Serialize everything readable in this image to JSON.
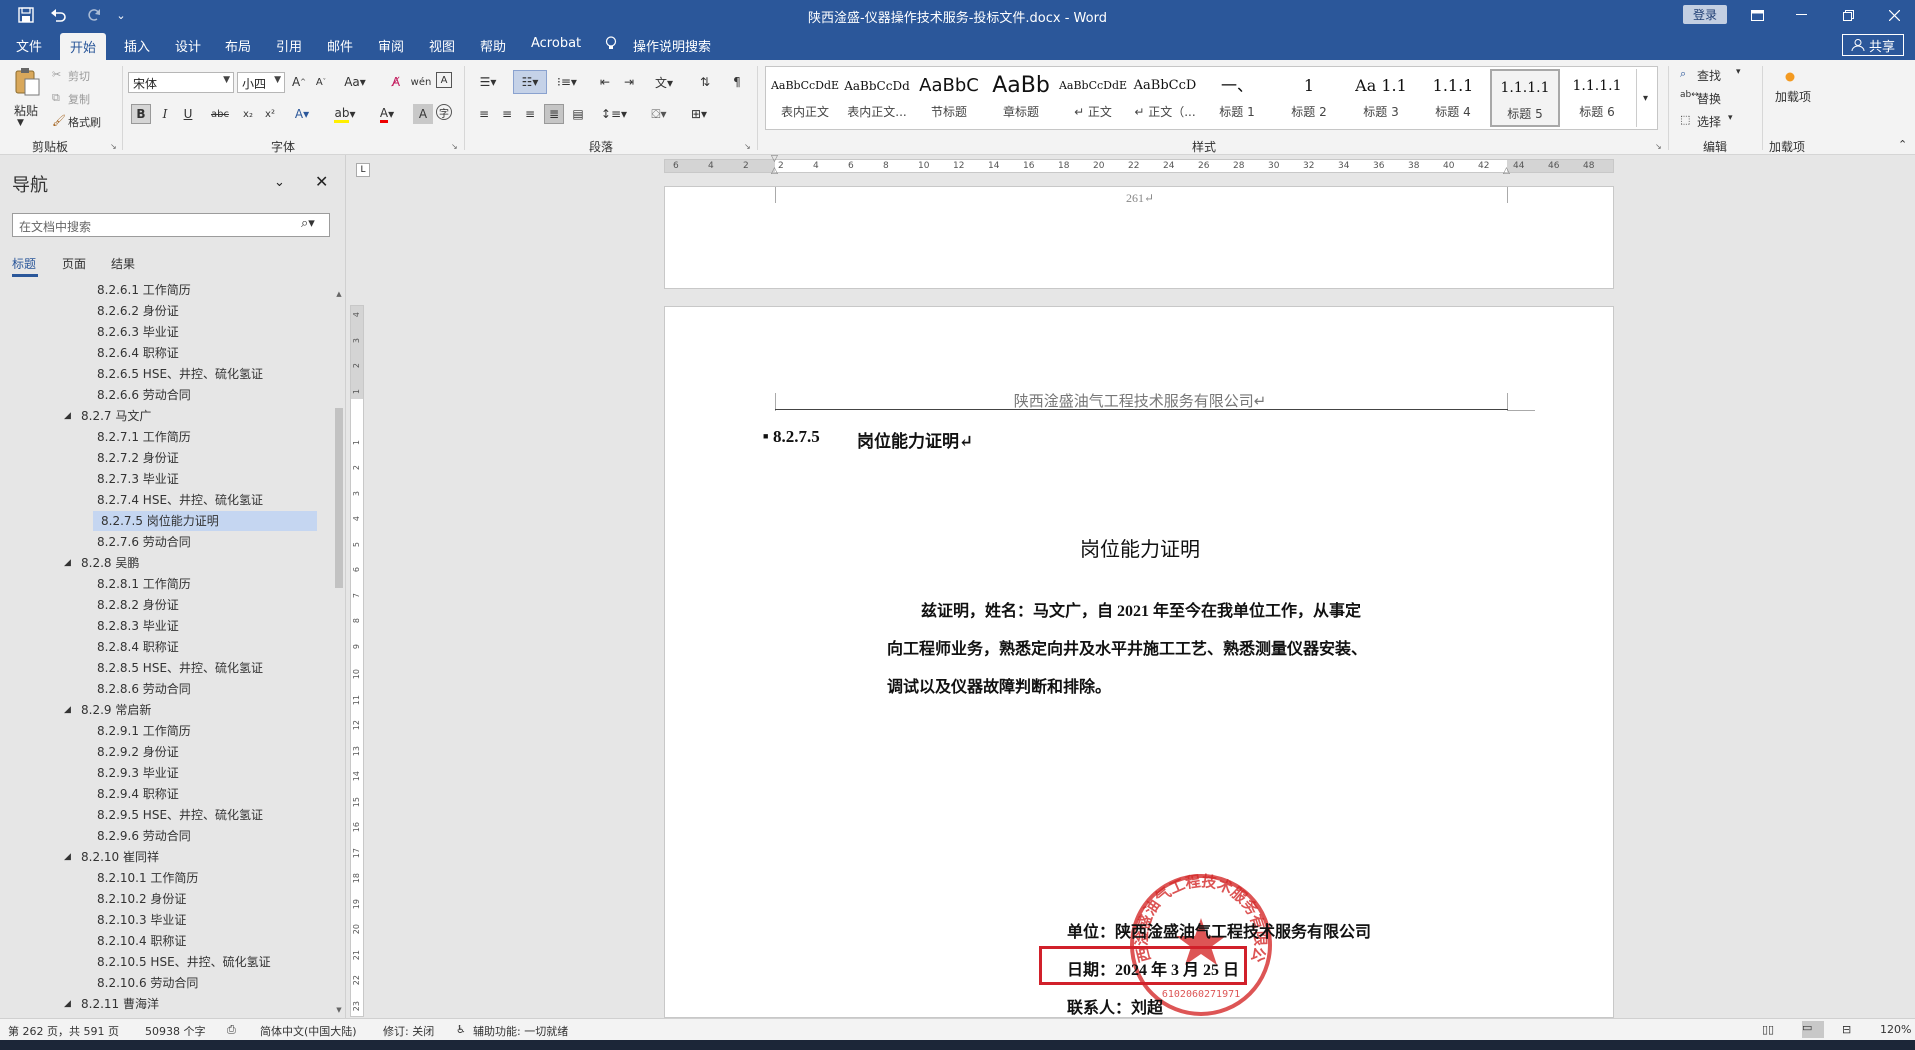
{
  "title_bar": {
    "document_title": "陕西淦盛-仪器操作技术服务-投标文件.docx - Word",
    "login_label": "登录",
    "save_icon": "save-icon",
    "undo_icon": "undo-icon",
    "redo_icon": "redo-icon",
    "customize_icon": "customize-quick-access-icon"
  },
  "menu": {
    "tabs": [
      "文件",
      "开始",
      "插入",
      "设计",
      "布局",
      "引用",
      "邮件",
      "审阅",
      "视图",
      "帮助",
      "Acrobat"
    ],
    "active_tab": "开始",
    "tell_me": "操作说明搜索",
    "share_label": "共享"
  },
  "ribbon": {
    "clipboard": {
      "paste": "粘贴",
      "cut": "剪切",
      "copy": "复制",
      "format_painter": "格式刷",
      "label": "剪贴板"
    },
    "font": {
      "name": "宋体",
      "size": "小四",
      "label": "字体"
    },
    "paragraph": {
      "label": "段落"
    },
    "styles": {
      "label": "样式",
      "items": [
        {
          "preview": "AaBbCcDdE",
          "name": "表内正文"
        },
        {
          "preview": "AaBbCcDd",
          "name": "表内正文..."
        },
        {
          "preview": "AaBbC",
          "name": "节标题"
        },
        {
          "preview": "AaBb",
          "name": "章标题"
        },
        {
          "preview": "AaBbCcDdE",
          "name": "↵ 正文"
        },
        {
          "preview": "AaBbCcD",
          "name": "↵ 正文（..."
        },
        {
          "preview": "一、",
          "name": "标题 1"
        },
        {
          "preview": "1",
          "name": "标题 2"
        },
        {
          "preview": "Aa",
          "name": "标题 3"
        },
        {
          "preview": "1.1",
          "name": "标题 3"
        },
        {
          "preview": "1.1.1",
          "name": "标题 4"
        },
        {
          "preview": "1.1.1.1",
          "name": "标题 5"
        },
        {
          "preview": "1.1.1.1",
          "name": "标题 6"
        }
      ],
      "selected_index": 11
    },
    "editing": {
      "find": "查找",
      "replace": "替换",
      "select": "选择",
      "label": "编辑"
    },
    "addins": {
      "button": "加载项",
      "label": "加载项"
    }
  },
  "nav": {
    "title": "导航",
    "search_placeholder": "在文档中搜索",
    "tabs": [
      "标题",
      "页面",
      "结果"
    ],
    "items": [
      {
        "text": "8.2.6.1 工作简历",
        "level": 2,
        "expandable": false
      },
      {
        "text": "8.2.6.2 身份证",
        "level": 2,
        "expandable": false
      },
      {
        "text": "8.2.6.3 毕业证",
        "level": 2,
        "expandable": false
      },
      {
        "text": "8.2.6.4 职称证",
        "level": 2,
        "expandable": false
      },
      {
        "text": "8.2.6.5 HSE、井控、硫化氢证",
        "level": 2,
        "expandable": false
      },
      {
        "text": "8.2.6.6 劳动合同",
        "level": 2,
        "expandable": false
      },
      {
        "text": "8.2.7 马文广",
        "level": 1,
        "expandable": true
      },
      {
        "text": "8.2.7.1 工作简历",
        "level": 2,
        "expandable": false
      },
      {
        "text": "8.2.7.2 身份证",
        "level": 2,
        "expandable": false
      },
      {
        "text": "8.2.7.3 毕业证",
        "level": 2,
        "expandable": false
      },
      {
        "text": "8.2.7.4 HSE、井控、硫化氢证",
        "level": 2,
        "expandable": false
      },
      {
        "text": "8.2.7.5 岗位能力证明",
        "level": 2,
        "expandable": false,
        "selected": true
      },
      {
        "text": "8.2.7.6 劳动合同",
        "level": 2,
        "expandable": false
      },
      {
        "text": "8.2.8 吴鹏",
        "level": 1,
        "expandable": true
      },
      {
        "text": "8.2.8.1 工作简历",
        "level": 2,
        "expandable": false
      },
      {
        "text": "8.2.8.2 身份证",
        "level": 2,
        "expandable": false
      },
      {
        "text": "8.2.8.3 毕业证",
        "level": 2,
        "expandable": false
      },
      {
        "text": "8.2.8.4 职称证",
        "level": 2,
        "expandable": false
      },
      {
        "text": "8.2.8.5 HSE、井控、硫化氢证",
        "level": 2,
        "expandable": false
      },
      {
        "text": "8.2.8.6 劳动合同",
        "level": 2,
        "expandable": false
      },
      {
        "text": "8.2.9 常启新",
        "level": 1,
        "expandable": true
      },
      {
        "text": "8.2.9.1 工作简历",
        "level": 2,
        "expandable": false
      },
      {
        "text": "8.2.9.2 身份证",
        "level": 2,
        "expandable": false
      },
      {
        "text": "8.2.9.3 毕业证",
        "level": 2,
        "expandable": false
      },
      {
        "text": "8.2.9.4 职称证",
        "level": 2,
        "expandable": false
      },
      {
        "text": "8.2.9.5 HSE、井控、硫化氢证",
        "level": 2,
        "expandable": false
      },
      {
        "text": "8.2.9.6 劳动合同",
        "level": 2,
        "expandable": false
      },
      {
        "text": "8.2.10 崔同祥",
        "level": 1,
        "expandable": true
      },
      {
        "text": "8.2.10.1 工作简历",
        "level": 2,
        "expandable": false
      },
      {
        "text": "8.2.10.2 身份证",
        "level": 2,
        "expandable": false
      },
      {
        "text": "8.2.10.3 毕业证",
        "level": 2,
        "expandable": false
      },
      {
        "text": "8.2.10.4 职称证",
        "level": 2,
        "expandable": false
      },
      {
        "text": "8.2.10.5 HSE、井控、硫化氢证",
        "level": 2,
        "expandable": false
      },
      {
        "text": "8.2.10.6 劳动合同",
        "level": 2,
        "expandable": false
      },
      {
        "text": "8.2.11 曹海洋",
        "level": 1,
        "expandable": true
      }
    ]
  },
  "document": {
    "ruler_marks": [
      "6",
      "4",
      "2",
      "2",
      "4",
      "6",
      "8",
      "10",
      "12",
      "14",
      "16",
      "18",
      "20",
      "22",
      "24",
      "26",
      "28",
      "30",
      "32",
      "34",
      "36",
      "38",
      "40",
      "42",
      "44",
      "46",
      "48"
    ],
    "prev_page_number": "261↵",
    "header_text": "陕西淦盛油气工程技术服务有限公司↵",
    "heading_number": "8.2.7.5",
    "heading_text": "岗位能力证明↵",
    "cert_title": "岗位能力证明",
    "body_lines": [
      "兹证明，姓名：马文广，自 2021 年至今在我单位工作，从事定",
      "向工程师业务，熟悉定向井及水平井施工工艺、熟悉测量仪器安装、",
      "调试以及仪器故障判断和排除。"
    ],
    "unit_line": "单位：陕西淦盛油气工程技术服务有限公司",
    "date_line": "日期：2024 年 3 月 25 日",
    "contact_line": "联系人：刘超",
    "stamp": {
      "outer_text": "陕西淦盛油气工程技术服务有限公司",
      "number": "6102060271971",
      "color": "#d42a2a"
    },
    "highlight_color": "#d1202a"
  },
  "status": {
    "page": "第 262 页，共 591 页",
    "words": "50938 个字",
    "language": "简体中文(中国大陆)",
    "track_changes": "修订: 关闭",
    "accessibility": "辅助功能: 一切就绪",
    "zoom": "120%"
  }
}
